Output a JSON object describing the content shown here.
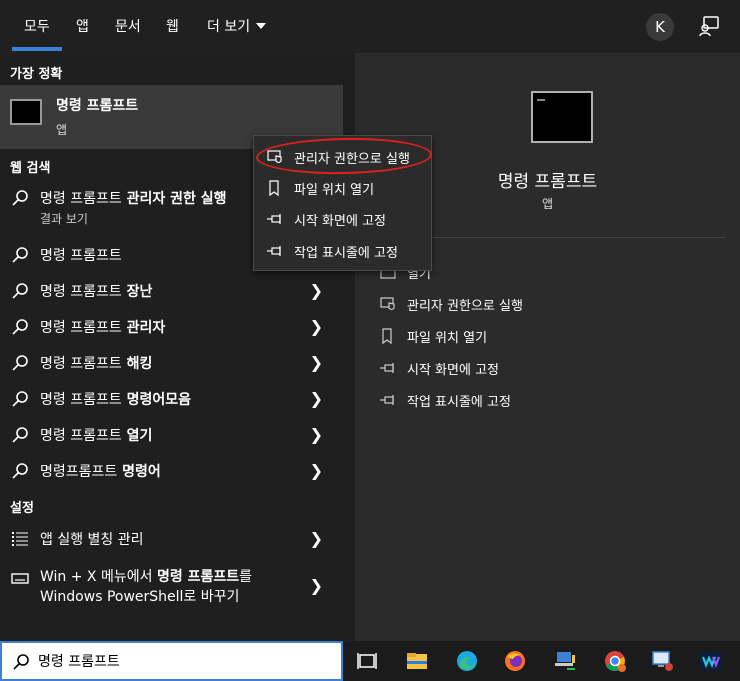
{
  "tabs": [
    {
      "label": "모두"
    },
    {
      "label": "앱"
    },
    {
      "label": "문서"
    },
    {
      "label": "웹"
    },
    {
      "label": "더 보기"
    }
  ],
  "account": {
    "initial": "K"
  },
  "sections": {
    "best_match": "가장 정확",
    "web_search": "웹 검색",
    "settings": "설정"
  },
  "best_match": {
    "title": "명령 프롬프트",
    "subtitle": "앱"
  },
  "web_results": [
    {
      "prefix": "명령 프롬프트",
      "bold": " 관리자 권한 실행",
      "sub": "결과 보기"
    },
    {
      "prefix": "명령 프롬프트",
      "bold": ""
    },
    {
      "prefix": "명령 프롬프트",
      "bold": " 장난"
    },
    {
      "prefix": "명령 프롬프트",
      "bold": " 관리자"
    },
    {
      "prefix": "명령 프롬프트",
      "bold": " 해킹"
    },
    {
      "prefix": "명령 프롬프트",
      "bold": " 명령어모음"
    },
    {
      "prefix": "명령 프롬프트",
      "bold": " 열기"
    },
    {
      "prefix": "명령프롬프트",
      "bold": " 명령어"
    }
  ],
  "settings_results": [
    {
      "label": "앱 실행 별칭 관리"
    },
    {
      "line1_prefix": "Win + X 메뉴에서 ",
      "line1_bold": "명령 프롬프트",
      "line1_suffix": "를",
      "line2": "Windows PowerShell로 바꾸기"
    }
  ],
  "search": {
    "value": "명령 프롬프트"
  },
  "preview": {
    "title": "명령 프롬프트",
    "subtitle": "앱",
    "actions": [
      {
        "label": "열기",
        "icon": "open-icon"
      },
      {
        "label": "관리자 권한으로 실행",
        "icon": "shield-icon"
      },
      {
        "label": "파일 위치 열기",
        "icon": "file-icon"
      },
      {
        "label": "시작 화면에 고정",
        "icon": "pin-icon"
      },
      {
        "label": "작업 표시줄에 고정",
        "icon": "pin-icon"
      }
    ]
  },
  "context_menu": [
    {
      "label": "관리자 권한으로 실행",
      "icon": "shield-icon"
    },
    {
      "label": "파일 위치 열기",
      "icon": "file-icon"
    },
    {
      "label": "시작 화면에 고정",
      "icon": "pin-icon"
    },
    {
      "label": "작업 표시줄에 고정",
      "icon": "pin-icon"
    }
  ],
  "taskbar": [
    {
      "name": "task-view-icon"
    },
    {
      "name": "file-explorer-icon"
    },
    {
      "name": "edge-icon"
    },
    {
      "name": "firefox-icon"
    },
    {
      "name": "network-icon"
    },
    {
      "name": "chrome-icon"
    },
    {
      "name": "remote-desktop-icon"
    },
    {
      "name": "webex-icon"
    }
  ],
  "colors": {
    "accent": "#3b82d4",
    "highlight": "#e02020"
  }
}
